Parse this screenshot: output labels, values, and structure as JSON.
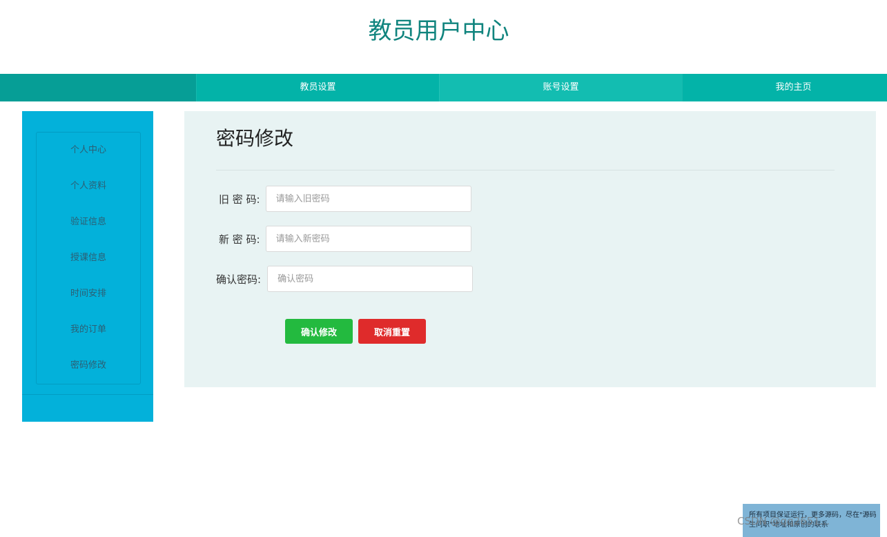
{
  "header": {
    "title": "教员用户中心"
  },
  "topnav": {
    "items": [
      {
        "label": "教员设置"
      },
      {
        "label": "账号设置"
      },
      {
        "label": "我的主页"
      }
    ]
  },
  "sidebar": {
    "items": [
      {
        "label": "个人中心"
      },
      {
        "label": "个人资料"
      },
      {
        "label": "验证信息"
      },
      {
        "label": "授课信息"
      },
      {
        "label": "时间安排"
      },
      {
        "label": "我的订单"
      },
      {
        "label": "密码修改"
      }
    ]
  },
  "main": {
    "heading": "密码修改",
    "fields": [
      {
        "label": "旧 密 码:",
        "placeholder": "请输入旧密码",
        "value": ""
      },
      {
        "label": "新 密 码:",
        "placeholder": "请输入新密码",
        "value": ""
      },
      {
        "label": "确认密码:",
        "placeholder": "确认密码",
        "value": ""
      }
    ],
    "confirm_label": "确认修改",
    "cancel_label": "取消重置"
  },
  "watermark": {
    "text": "所有项目保证运行，更多源码，尽在\"源码生问职\"地址和原创的联系",
    "brand": "CSDN @qq2651..."
  },
  "colors": {
    "accent": "#03b3a8",
    "sidebar": "#03b1da",
    "title": "#10847e",
    "confirm": "#23ba3f",
    "cancel": "#df2b2b"
  }
}
